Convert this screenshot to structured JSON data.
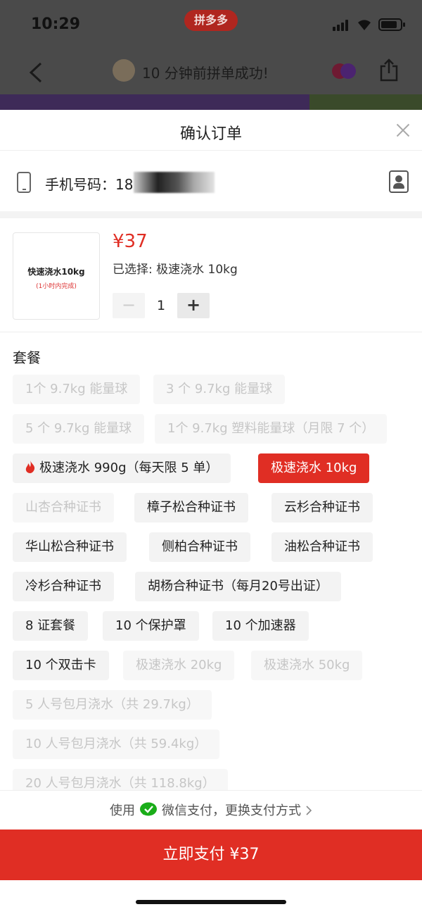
{
  "status_bar": {
    "time": "10:29"
  },
  "background_app": {
    "badge": "拼多多",
    "notice": "10 分钟前拼单成功!"
  },
  "sheet": {
    "title": "确认订单"
  },
  "phone": {
    "label": "手机号码：",
    "value_visible": "18"
  },
  "product": {
    "image_title": "快速浇水10kg",
    "image_subtitle": "(1小时内完成)",
    "price": "¥37",
    "selected_text": "已选择: 极速浇水 10kg",
    "quantity": "1",
    "minus": "−",
    "plus": "+"
  },
  "package": {
    "label": "套餐",
    "options": [
      "1个 9.7kg 能量球",
      "3 个 9.7kg 能量球",
      "5 个 9.7kg 能量球",
      "1个 9.7kg 塑料能量球（月限 7 个）",
      "极速浇水 990g（每天限 5 单）",
      "极速浇水 10kg",
      "山杏合种证书",
      "樟子松合种证书",
      "云杉合种证书",
      "华山松合种证书",
      "侧柏合种证书",
      "油松合种证书",
      "冷杉合种证书",
      "胡杨合种证书（每月20号出证）",
      "8 证套餐",
      "10 个保护罩",
      "10 个加速器",
      "10 个双击卡",
      "极速浇水 20kg",
      "极速浇水 50kg",
      "5 人号包月浇水（共 29.7kg）",
      "10 人号包月浇水（共 59.4kg）",
      "20 人号包月浇水（共 118.8kg）"
    ]
  },
  "payment": {
    "prefix": "使用",
    "method": "微信支付，更换支付方式",
    "pay_button": "立即支付 ¥37"
  },
  "colors": {
    "accent": "#e02e24",
    "wechat": "#1aad19"
  }
}
